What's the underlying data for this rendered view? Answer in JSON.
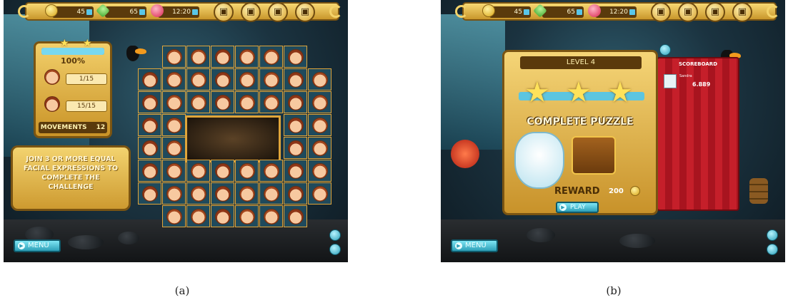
{
  "panel_a": {
    "topbar": {
      "coins": "45",
      "gems": "65",
      "time": "12:20"
    },
    "score": {
      "percent": "100%",
      "progress_fraction": 1.0,
      "boy_count": "1/15",
      "girl_count": "15/15",
      "movements_label": "MOVEMENTS",
      "movements_value": "12"
    },
    "instructions": "JOIN 3 OR MORE EQUAL FACIAL EXPRESSIONS TO COMPLETE THE CHALLENGE",
    "menu_label": "MENU"
  },
  "panel_b": {
    "topbar": {
      "coins": "45",
      "gems": "65",
      "time": "12:20"
    },
    "level_title": "LEVEL 4",
    "complete_text": "COMPLETE PUZZLE",
    "reward_label": "REWARD",
    "reward_value": "200",
    "play_label": "PLAY",
    "scoreboard": {
      "title": "SCOREBOARD",
      "player_name": "Sandra",
      "player_score": "6.889"
    },
    "menu_label": "MENU"
  },
  "captions": {
    "a": "(a)",
    "b": "(b)"
  },
  "icons": {
    "coin": "coin-icon",
    "gem": "gem-icon",
    "heart": "heart-icon",
    "lock": "lock-icon",
    "play": "play-icon"
  }
}
